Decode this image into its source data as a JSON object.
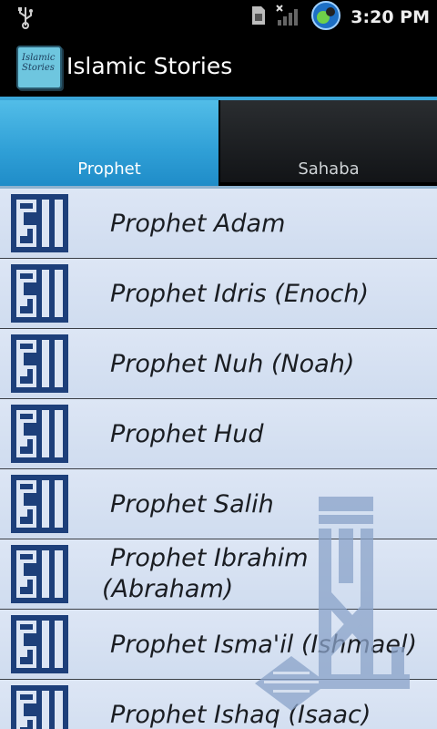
{
  "status_bar": {
    "time": "3:20 PM",
    "icons": [
      "usb-icon",
      "sim-icon",
      "signal-icon",
      "sync-app-icon"
    ]
  },
  "app": {
    "title": "Islamic Stories",
    "icon_text_line1": "Islamic",
    "icon_text_line2": "Stories"
  },
  "tabs": [
    {
      "label": "Prophet",
      "active": true
    },
    {
      "label": "Sahaba",
      "active": false
    }
  ],
  "list": {
    "items": [
      {
        "label": "Prophet Adam"
      },
      {
        "label": "Prophet Idris (Enoch)"
      },
      {
        "label": "Prophet Nuh (Noah)"
      },
      {
        "label": "Prophet Hud"
      },
      {
        "label": "Prophet Salih"
      },
      {
        "label_line1": "Prophet Ibrahim",
        "label_line2": "(Abraham)"
      },
      {
        "label": "Prophet Isma'il (Ishmael)"
      },
      {
        "label": "Prophet Ishaq (Isaac)"
      }
    ]
  },
  "colors": {
    "active_tab": "#2f9fd6",
    "inactive_tab": "#1b1e21",
    "list_background": "#d6e1f2",
    "icon_blue": "#1d3f7a",
    "divider": "#3aa6d8"
  }
}
